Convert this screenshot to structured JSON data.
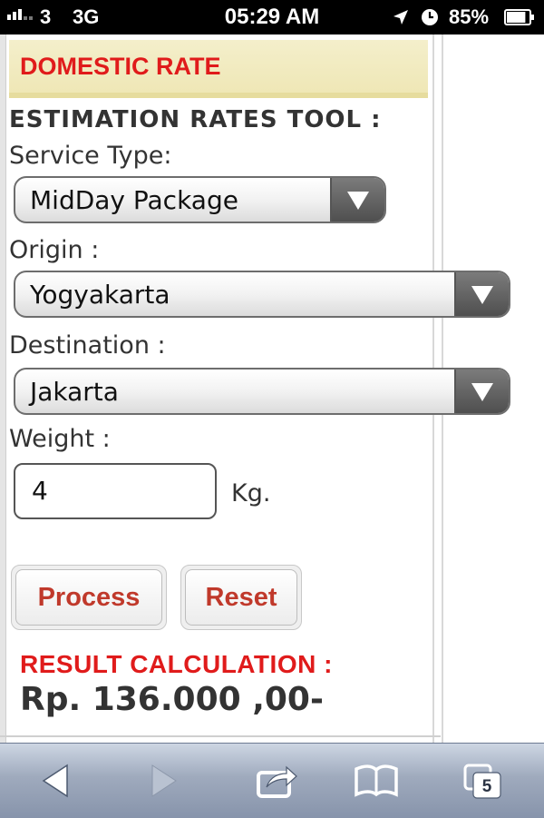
{
  "status_bar": {
    "carrier": "3",
    "network": "3G",
    "time": "05:29 AM",
    "battery_percent": "85%",
    "battery_level": 0.85,
    "icons": [
      "signal-icon",
      "location-arrow-icon",
      "clock-icon",
      "battery-icon"
    ]
  },
  "page": {
    "header": "DOMESTIC RATE",
    "tool_title": "ESTIMATION RATES TOOL :",
    "service_type": {
      "label": "Service Type:",
      "value": "MidDay Package"
    },
    "origin": {
      "label": "Origin :",
      "value": "Yogyakarta"
    },
    "destination": {
      "label": "Destination :",
      "value": "Jakarta"
    },
    "weight": {
      "label": "Weight :",
      "value": "4",
      "unit": "Kg."
    },
    "buttons": {
      "process": "Process",
      "reset": "Reset"
    },
    "result": {
      "label": "RESULT CALCULATION :",
      "value": "Rp. 136.000 ,00-"
    }
  },
  "toolbar": {
    "tabs_count": "5",
    "icons": [
      "back-icon",
      "forward-icon",
      "share-icon",
      "bookmarks-icon",
      "tabs-icon"
    ]
  },
  "colors": {
    "accent_red": "#e01b1b",
    "button_text": "#c0392b",
    "header_band": "#f4efcb"
  }
}
